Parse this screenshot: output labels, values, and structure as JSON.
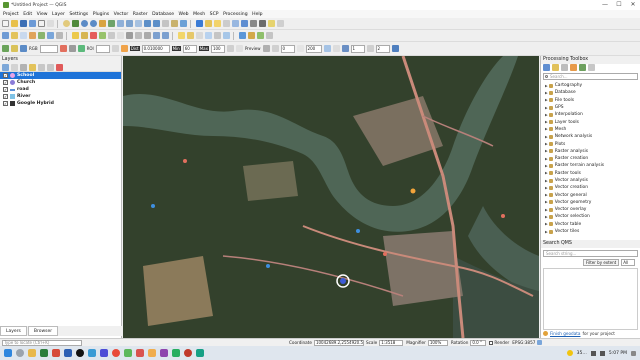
{
  "window": {
    "title": "*Untitled Project — QGIS",
    "controls": [
      "—",
      "☐",
      "✕"
    ]
  },
  "menu": [
    "Project",
    "Edit",
    "View",
    "Layer",
    "Settings",
    "Plugins",
    "Vector",
    "Raster",
    "Database",
    "Web",
    "Mesh",
    "SCP",
    "Processing",
    "Help"
  ],
  "toolbar3": {
    "rgb_label": "RGB",
    "roi_label": "ROI",
    "dist_label": "Dist",
    "dist_value": "0.010000",
    "min_label": "Min",
    "min_value": "60",
    "max_label": "Max",
    "max_value": "100",
    "preview_label": "Preview",
    "spin1": "0",
    "spin2": "200",
    "spin3": "1",
    "spin4": "2"
  },
  "layers": {
    "title": "Layers",
    "items": [
      {
        "name": "School",
        "checked": true,
        "selected": true,
        "color": "#e8a3e6"
      },
      {
        "name": "Church",
        "checked": true,
        "selected": false,
        "color": "#8a7bd8"
      },
      {
        "name": "road",
        "checked": true,
        "selected": false,
        "color": "#5a8fd6"
      },
      {
        "name": "River",
        "checked": true,
        "selected": false,
        "color": "#7fc3e6"
      },
      {
        "name": "Google Hybrid",
        "checked": true,
        "selected": false,
        "color": "#333333"
      }
    ],
    "tabs": [
      "Layers",
      "Browser"
    ]
  },
  "toolbox": {
    "title": "Processing Toolbox",
    "search_placeholder": "Search...",
    "items": [
      "Cartography",
      "Database",
      "File tools",
      "GPS",
      "Interpolation",
      "Layer tools",
      "Mesh",
      "Network analysis",
      "Plots",
      "Raster analysis",
      "Raster creation",
      "Raster terrain analysis",
      "Raster tools",
      "Vector analysis",
      "Vector creation",
      "Vector general",
      "Vector geometry",
      "Vector overlay",
      "Vector selection",
      "Vector table",
      "Vector tiles"
    ]
  },
  "searchqms": {
    "title": "Search QMS",
    "placeholder": "Search string...",
    "filter_label": "Filter by extent",
    "filter_value": "All",
    "footer_link": "Finish geodata",
    "footer_text": "for your project"
  },
  "status": {
    "locate_placeholder": "Type to locate (Ctrl+K)",
    "coordinate_label": "Coordinate",
    "coordinate_value": "10042689.2,2554920.5",
    "scale_label": "Scale",
    "scale_value": "1:3518",
    "magnifier_label": "Magnifier",
    "magnifier_value": "100%",
    "rotation_label": "Rotation",
    "rotation_value": "0.0 °",
    "render_label": "Render",
    "crs": "EPSG:3857"
  },
  "taskbar": {
    "temperature": "35…",
    "time": "5:07 PM"
  },
  "colors": {
    "selection": "#1e73d8",
    "river": "#556b5a",
    "road": "#c98a7a",
    "link": "#1a5fb4"
  }
}
